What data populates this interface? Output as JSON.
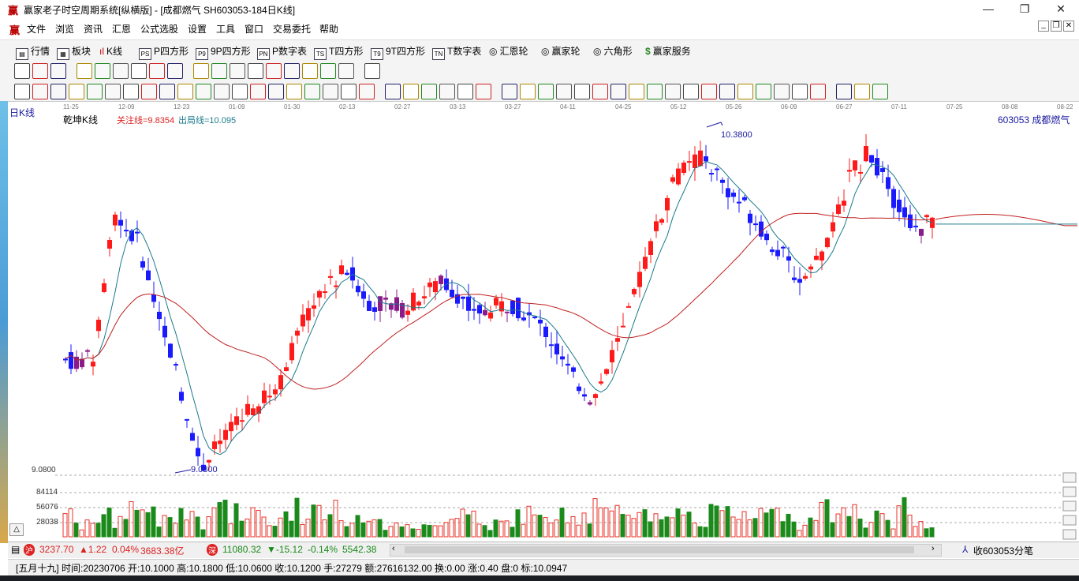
{
  "window": {
    "title": "赢家老子时空周期系统[纵横版] - [成都燃气  SH603053-184日K线]",
    "app_icon": "赢",
    "controls": {
      "minimize": "—",
      "restore": "❐",
      "close": "✕"
    },
    "mdi_controls": {
      "minimize": "_",
      "restore": "❐",
      "close": "✕"
    }
  },
  "menu": [
    "文件",
    "浏览",
    "资讯",
    "汇恩",
    "公式选股",
    "设置",
    "工具",
    "窗口",
    "交易委托",
    "帮助"
  ],
  "toolbar_main": [
    {
      "label": "行情",
      "icon": "table-icon"
    },
    {
      "label": "板块",
      "icon": "grid-icon"
    },
    {
      "label": "K线",
      "icon": "candlestick-icon"
    },
    {
      "label": "P四方形",
      "icon": "ps-icon",
      "badge": "PS"
    },
    {
      "label": "9P四方形",
      "icon": "p9-icon",
      "badge": "P9"
    },
    {
      "label": "P数字表",
      "icon": "pn-icon",
      "badge": "PN"
    },
    {
      "label": "T四方形",
      "icon": "ts-icon",
      "badge": "TS"
    },
    {
      "label": "9T四方形",
      "icon": "t9-icon",
      "badge": "T9"
    },
    {
      "label": "T数字表",
      "icon": "tn-icon",
      "badge": "TN"
    },
    {
      "label": "汇恩轮",
      "icon": "wheel-icon"
    },
    {
      "label": "赢家轮",
      "icon": "wheel-icon"
    },
    {
      "label": "六角形",
      "icon": "hexagon-icon"
    },
    {
      "label": "赢家服务",
      "icon": "dollar-icon"
    }
  ],
  "chart": {
    "period_label": "日K线",
    "indicator_name": "乾坤K线",
    "attention_line": "关注线=9.8354",
    "exit_line": "出局线=10.095",
    "stock": "603053  成都燃气",
    "date_ticks": [
      "11-25",
      "12-09",
      "12-23",
      "01-09",
      "01-30",
      "02-13",
      "02-27",
      "03-13",
      "03-27",
      "04-11",
      "04-25",
      "05-12",
      "05-26",
      "06-09",
      "06-27",
      "07-11",
      "07-25",
      "08-08",
      "08-22"
    ],
    "high_label": "10.3800",
    "low_label": "9.0800",
    "price_axis_label": "9.0800",
    "volume_ticks": [
      "84114",
      "56076",
      "28038"
    ],
    "colors": {
      "up": "#ff1a1a",
      "down": "#1a1aff",
      "neutral": "#8b1a8b",
      "vol_up": "#e8332a",
      "vol_down": "#1a8a1a",
      "ma_fast": "#1a7a8a",
      "ma_slow": "#c02020"
    }
  },
  "chart_data": {
    "type": "candlestick",
    "ohlc_shape": "approximate daily K-line, price range 9.08 – 10.38",
    "high": 10.38,
    "low": 9.08
  },
  "status": {
    "index1": "3237.70",
    "index1_change": "▲1.22",
    "index1_pct": "0.04%",
    "index1_amount": "3683.38亿",
    "index2": "11080.32",
    "index2_change": "▼-15.12",
    "index2_pct": "-0.14%",
    "index2_amount": "5542.38",
    "right": "收603053分笔"
  },
  "info": "[五月十九] 时间:20230706 开:10.1000 高:10.1800 低:10.0600 收:10.1200 手:27279 额:27616132.00 换:0.00 涨:0.40 盘:0 标:10.0947"
}
